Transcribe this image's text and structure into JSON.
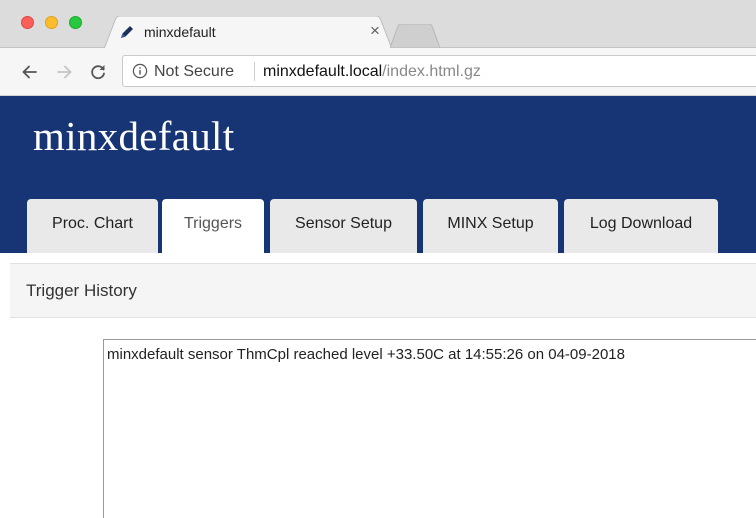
{
  "browser": {
    "tab_title": "minxdefault",
    "tab_close": "×",
    "security_label": "Not Secure",
    "url_host": "minxdefault.local",
    "url_path": "/index.html.gz"
  },
  "header": {
    "site_title": "minxdefault"
  },
  "nav": {
    "tabs": [
      {
        "label": "Proc. Chart",
        "active": false
      },
      {
        "label": "Triggers",
        "active": true
      },
      {
        "label": "Sensor Setup",
        "active": false
      },
      {
        "label": "MINX Setup",
        "active": false
      },
      {
        "label": "Log Download",
        "active": false
      }
    ]
  },
  "main": {
    "section_title": "Trigger History",
    "history": [
      "minxdefault sensor ThmCpl reached level +33.50C at 14:55:26 on 04-09-2018"
    ]
  },
  "icons": {
    "favicon": "pen-icon",
    "back": "back-arrow-icon",
    "forward": "forward-arrow-icon",
    "reload": "reload-icon",
    "security": "info-icon"
  },
  "colors": {
    "header_bg": "#173474",
    "close_red": "#fc5f57",
    "minimize_yellow": "#fdbc2e",
    "zoom_green": "#28c840"
  }
}
